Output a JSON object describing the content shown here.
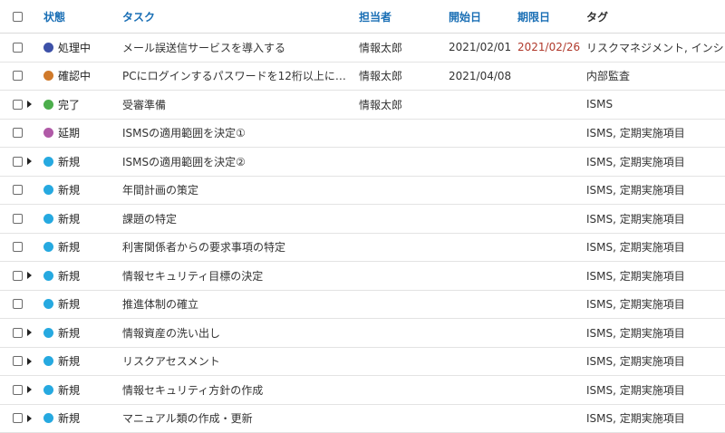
{
  "header": {
    "status": "状態",
    "task": "タスク",
    "assignee": "担当者",
    "start": "開始日",
    "due": "期限日",
    "tags": "タグ"
  },
  "status_colors": {
    "処理中": "#3d51a8",
    "確認中": "#d07a2b",
    "完了": "#4cae4c",
    "延期": "#b05aa7",
    "新規": "#26a9e0"
  },
  "overdue_color": "#b0392b",
  "rows": [
    {
      "expandable": false,
      "status": "処理中",
      "status_color": "#3d51a8",
      "task": "メール誤送信サービスを導入する",
      "assignee": "情報太郎",
      "start": "2021/02/01",
      "due": "2021/02/26",
      "due_overdue": true,
      "tags": "リスクマネジメント, インシ"
    },
    {
      "expandable": false,
      "status": "確認中",
      "status_color": "#d07a2b",
      "task": "PCにログインするパスワードを12桁以上に…",
      "assignee": "情報太郎",
      "start": "2021/04/08",
      "due": "",
      "due_overdue": false,
      "tags": "内部監査"
    },
    {
      "expandable": true,
      "status": "完了",
      "status_color": "#4cae4c",
      "task": "受審準備",
      "assignee": "情報太郎",
      "start": "",
      "due": "",
      "due_overdue": false,
      "tags": "ISMS"
    },
    {
      "expandable": false,
      "status": "延期",
      "status_color": "#b05aa7",
      "task": "ISMSの適用範囲を決定①",
      "assignee": "",
      "start": "",
      "due": "",
      "due_overdue": false,
      "tags": "ISMS, 定期実施項目"
    },
    {
      "expandable": true,
      "status": "新規",
      "status_color": "#26a9e0",
      "task": "ISMSの適用範囲を決定②",
      "assignee": "",
      "start": "",
      "due": "",
      "due_overdue": false,
      "tags": "ISMS, 定期実施項目"
    },
    {
      "expandable": false,
      "status": "新規",
      "status_color": "#26a9e0",
      "task": "年間計画の策定",
      "assignee": "",
      "start": "",
      "due": "",
      "due_overdue": false,
      "tags": "ISMS, 定期実施項目"
    },
    {
      "expandable": false,
      "status": "新規",
      "status_color": "#26a9e0",
      "task": "課題の特定",
      "assignee": "",
      "start": "",
      "due": "",
      "due_overdue": false,
      "tags": "ISMS, 定期実施項目"
    },
    {
      "expandable": false,
      "status": "新規",
      "status_color": "#26a9e0",
      "task": "利害関係者からの要求事項の特定",
      "assignee": "",
      "start": "",
      "due": "",
      "due_overdue": false,
      "tags": "ISMS, 定期実施項目"
    },
    {
      "expandable": true,
      "status": "新規",
      "status_color": "#26a9e0",
      "task": "情報セキュリティ目標の決定",
      "assignee": "",
      "start": "",
      "due": "",
      "due_overdue": false,
      "tags": "ISMS, 定期実施項目"
    },
    {
      "expandable": false,
      "status": "新規",
      "status_color": "#26a9e0",
      "task": "推進体制の確立",
      "assignee": "",
      "start": "",
      "due": "",
      "due_overdue": false,
      "tags": "ISMS, 定期実施項目"
    },
    {
      "expandable": true,
      "status": "新規",
      "status_color": "#26a9e0",
      "task": "情報資産の洗い出し",
      "assignee": "",
      "start": "",
      "due": "",
      "due_overdue": false,
      "tags": "ISMS, 定期実施項目"
    },
    {
      "expandable": true,
      "status": "新規",
      "status_color": "#26a9e0",
      "task": "リスクアセスメント",
      "assignee": "",
      "start": "",
      "due": "",
      "due_overdue": false,
      "tags": "ISMS, 定期実施項目"
    },
    {
      "expandable": true,
      "status": "新規",
      "status_color": "#26a9e0",
      "task": "情報セキュリティ方針の作成",
      "assignee": "",
      "start": "",
      "due": "",
      "due_overdue": false,
      "tags": "ISMS, 定期実施項目"
    },
    {
      "expandable": true,
      "status": "新規",
      "status_color": "#26a9e0",
      "task": "マニュアル類の作成・更新",
      "assignee": "",
      "start": "",
      "due": "",
      "due_overdue": false,
      "tags": "ISMS, 定期実施項目"
    }
  ]
}
